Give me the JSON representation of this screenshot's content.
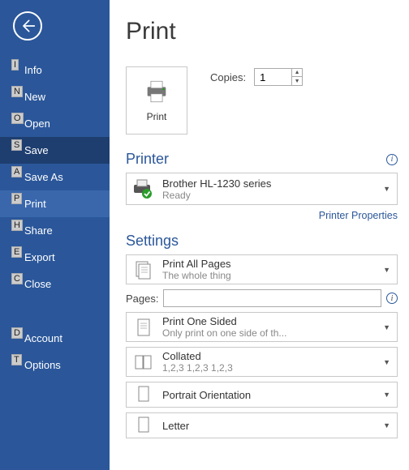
{
  "sidebar": {
    "items": [
      {
        "key": "I",
        "label": "Info"
      },
      {
        "key": "N",
        "label": "New"
      },
      {
        "key": "O",
        "label": "Open"
      },
      {
        "key": "S",
        "label": "Save"
      },
      {
        "key": "A",
        "label": "Save As"
      },
      {
        "key": "P",
        "label": "Print"
      },
      {
        "key": "H",
        "label": "Share"
      },
      {
        "key": "E",
        "label": "Export"
      },
      {
        "key": "C",
        "label": "Close"
      },
      {
        "key": "D",
        "label": "Account"
      },
      {
        "key": "T",
        "label": "Options"
      }
    ]
  },
  "main": {
    "title": "Print",
    "print_button": "Print",
    "copies_label": "Copies:",
    "copies_value": "1",
    "printer_section": "Printer",
    "printer": {
      "name": "Brother HL-1230 series",
      "status": "Ready"
    },
    "printer_properties": "Printer Properties",
    "settings_section": "Settings",
    "pages_label": "Pages:",
    "pages_value": "",
    "setting_scope": {
      "title": "Print All Pages",
      "sub": "The whole thing"
    },
    "setting_sides": {
      "title": "Print One Sided",
      "sub": "Only print on one side of th..."
    },
    "setting_collate": {
      "title": "Collated",
      "sub": "1,2,3    1,2,3    1,2,3"
    },
    "setting_orient": {
      "title": "Portrait Orientation"
    },
    "setting_paper": {
      "title": "Letter"
    }
  }
}
